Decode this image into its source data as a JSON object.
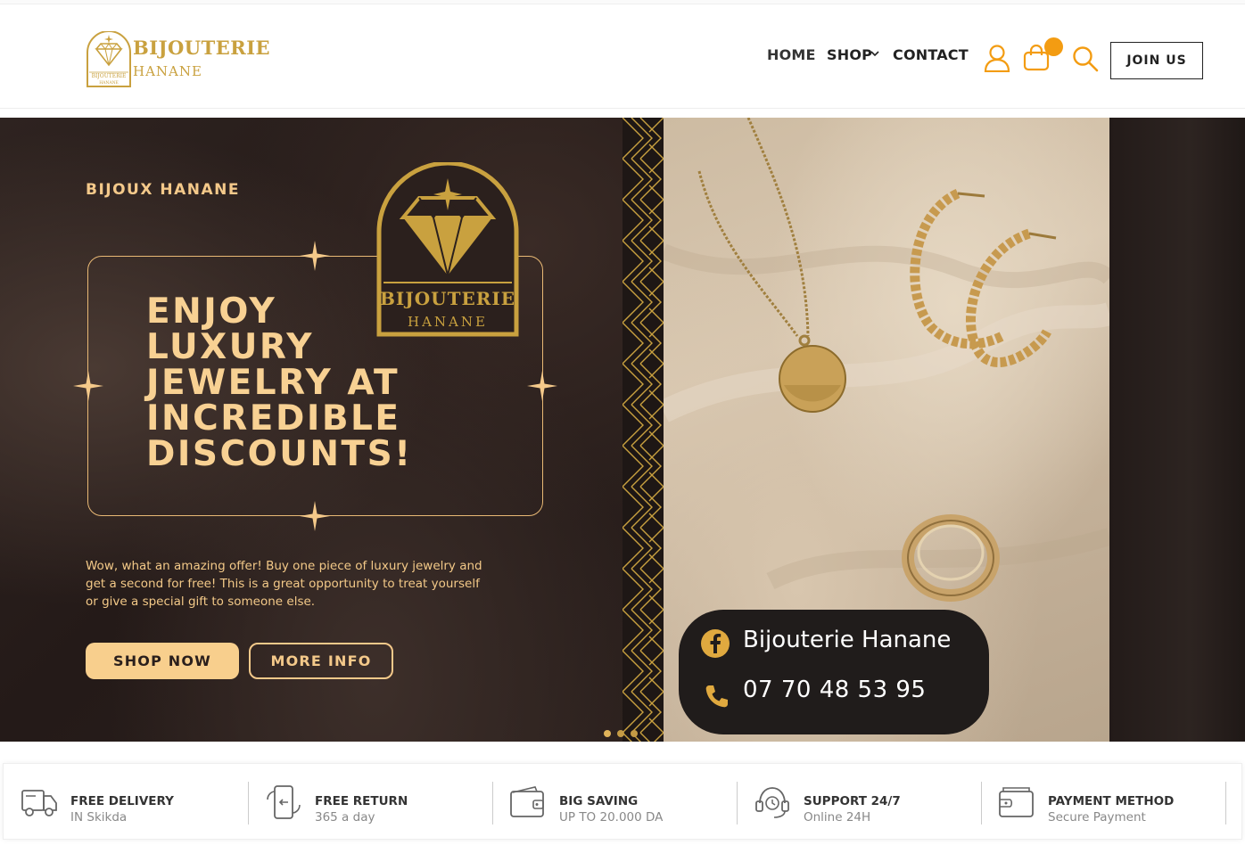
{
  "brand": {
    "name_line1": "BIJOUTERIE",
    "name_line2": "HANANE",
    "badge_line1": "BIJOUTERIE",
    "badge_line2": "HANANE",
    "badge_small": "BIJOUTERIE HANANE",
    "gold": "#c9a13f"
  },
  "nav": {
    "home": "HOME",
    "shop": "SHOP",
    "contact": "CONTACT",
    "join": "JOIN US",
    "accent": "#f39c12",
    "icons": [
      "user-icon",
      "shopping-bag-icon",
      "search-icon"
    ]
  },
  "hero": {
    "subtitle": "BIJOUX HANANE",
    "headline": [
      "ENJOY",
      "LUXURY",
      "JEWELRY AT",
      "INCREDIBLE",
      "DISCOUNTS!"
    ],
    "description": "Wow, what an amazing offer! Buy one piece of luxury jewelry and get a second for free! This is a great opportunity to treat yourself or give a special gift to someone else.",
    "shop_now": "SHOP NOW",
    "more_info": "MORE INFO",
    "facebook_name": "Bijouterie Hanane",
    "phone": "07 70 48 53 95",
    "slides": 3,
    "active_slide": 1,
    "accent": "#f8cf8d"
  },
  "features": [
    {
      "title": "FREE DELIVERY",
      "subtitle": "IN Skikda",
      "icon": "truck-icon"
    },
    {
      "title": "FREE RETURN",
      "subtitle": "365 a day",
      "icon": "return-phone-icon"
    },
    {
      "title": "BIG SAVING",
      "subtitle": "UP TO 20.000 DA",
      "icon": "wallet-icon"
    },
    {
      "title": "SUPPORT 24/7",
      "subtitle": "Online 24H",
      "icon": "headset-icon"
    },
    {
      "title": "PAYMENT METHOD",
      "subtitle": "Secure Payment",
      "icon": "card-wallet-icon"
    }
  ]
}
